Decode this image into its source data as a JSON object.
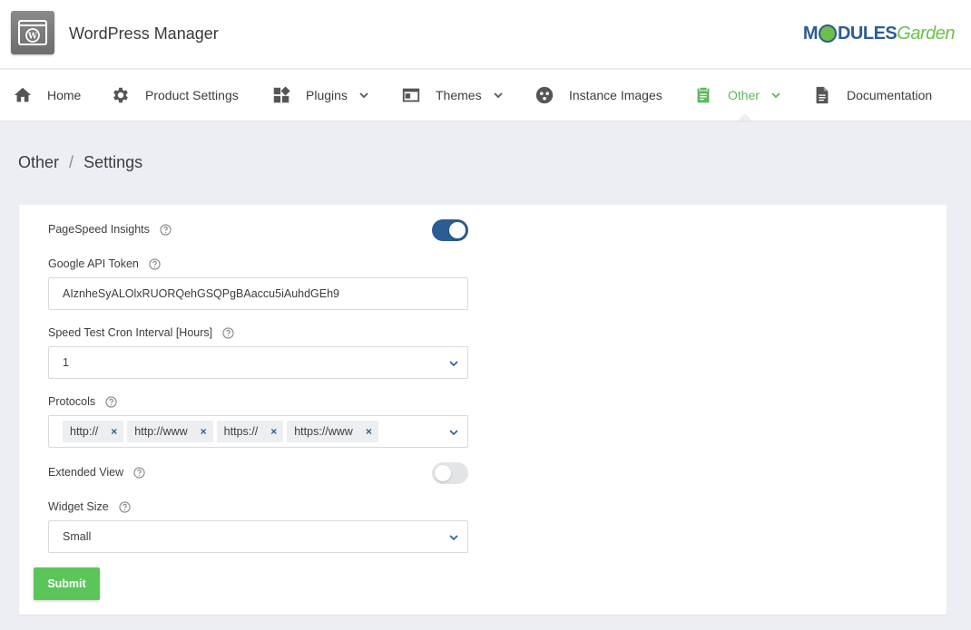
{
  "header": {
    "app_title": "WordPress Manager",
    "brand_left": "M",
    "brand_mid": "DULES",
    "brand_right": "Garden"
  },
  "nav": {
    "items": [
      {
        "label": "Home",
        "icon": "home-icon"
      },
      {
        "label": "Product Settings",
        "icon": "gear-icon"
      },
      {
        "label": "Plugins",
        "icon": "widgets-icon",
        "dropdown": true
      },
      {
        "label": "Themes",
        "icon": "browser-window-icon",
        "dropdown": true
      },
      {
        "label": "Instance Images",
        "icon": "instance-images-icon"
      },
      {
        "label": "Other",
        "icon": "clipboard-icon",
        "dropdown": true,
        "active": true
      },
      {
        "label": "Documentation",
        "icon": "document-icon"
      }
    ]
  },
  "breadcrumb": {
    "parent": "Other",
    "separator": "/",
    "current": "Settings"
  },
  "form": {
    "pagespeed": {
      "label": "PageSpeed Insights",
      "enabled": true
    },
    "api_token": {
      "label": "Google API Token",
      "value": "AIznheSyALOlxRUORQehGSQPgBAaccu5iAuhdGEh9"
    },
    "cron_interval": {
      "label": "Speed Test Cron Interval [Hours]",
      "value": "1"
    },
    "protocols": {
      "label": "Protocols",
      "tags": [
        "http://",
        "http://www",
        "https://",
        "https://www"
      ],
      "remove_glyph": "×"
    },
    "extended_view": {
      "label": "Extended View",
      "enabled": false
    },
    "widget_size": {
      "label": "Widget Size",
      "value": "Small"
    },
    "submit_label": "Submit"
  },
  "colors": {
    "accent_blue": "#2b5c95",
    "accent_green": "#5cb85c",
    "background": "#edeef3"
  }
}
